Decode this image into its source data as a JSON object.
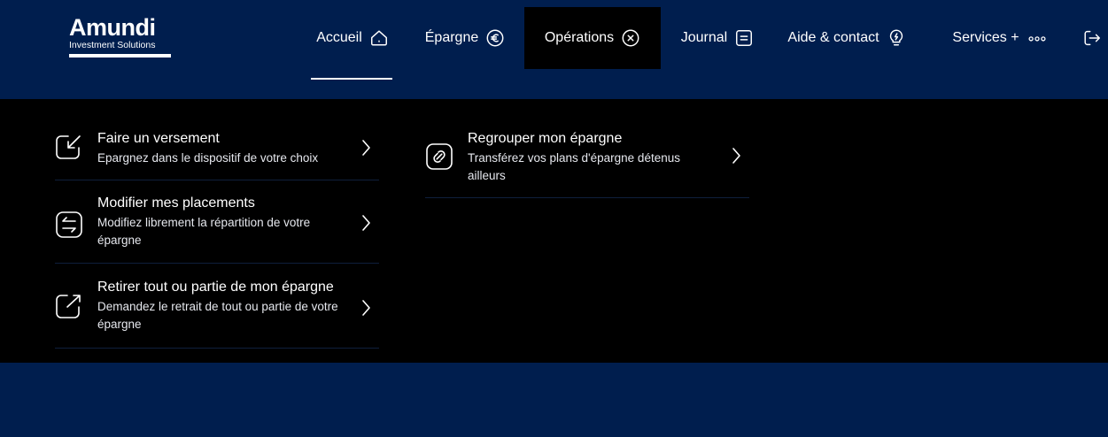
{
  "brand": {
    "name": "Amundi",
    "tagline": "Investment Solutions"
  },
  "nav": {
    "items": [
      {
        "label": "Accueil",
        "icon": "home-icon"
      },
      {
        "label": "Épargne",
        "icon": "euro-icon"
      },
      {
        "label": "Opérations",
        "icon": "close-circle-icon"
      },
      {
        "label": "Journal",
        "icon": "document-icon"
      },
      {
        "label": "Aide & contact",
        "icon": "lightbulb-icon"
      },
      {
        "label": "Services +",
        "icon": "more-dots-icon"
      }
    ],
    "logout_icon": "logout-icon"
  },
  "menu": {
    "left": [
      {
        "title": "Faire un versement",
        "desc": "Epargnez dans le dispositif de votre choix",
        "icon": "deposit-arrow-icon"
      },
      {
        "title": "Modifier mes placements",
        "desc": "Modifiez librement la répartition de votre épargne",
        "icon": "switch-arrows-icon"
      },
      {
        "title": "Retirer tout ou partie de mon épargne",
        "desc": "Demandez le retrait de tout ou partie de votre épargne",
        "icon": "withdraw-arrow-icon"
      }
    ],
    "right": [
      {
        "title": "Regrouper mon épargne",
        "desc": "Transférez vos plans d'épargne détenus ailleurs",
        "icon": "link-circle-icon"
      }
    ]
  },
  "colors": {
    "header": "#001e4e",
    "panel": "#000000",
    "text": "#ffffff",
    "divider": "#0f1f3c"
  }
}
